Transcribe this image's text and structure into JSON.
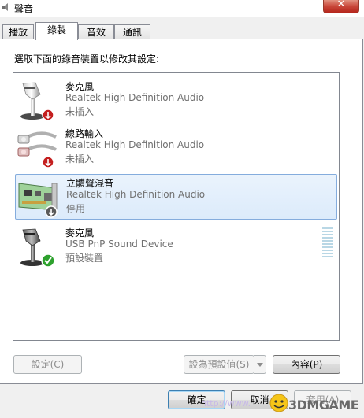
{
  "window": {
    "title": "聲音",
    "close_glyph": "✕"
  },
  "tabs": [
    {
      "label": "播放",
      "active": false
    },
    {
      "label": "錄製",
      "active": true
    },
    {
      "label": "音效",
      "active": false
    },
    {
      "label": "通訊",
      "active": false
    }
  ],
  "instruction": "選取下面的錄音裝置以修改其設定:",
  "devices": [
    {
      "name": "麥克風",
      "description": "Realtek High Definition Audio",
      "status": "未插入",
      "icon": "microphone-icon",
      "badge": "unplugged-badge-icon",
      "selected": false
    },
    {
      "name": "線路輸入",
      "description": "Realtek High Definition Audio",
      "status": "未插入",
      "icon": "line-in-cable-icon",
      "badge": "unplugged-badge-icon",
      "selected": false
    },
    {
      "name": "立體聲混音",
      "description": "Realtek High Definition Audio",
      "status": "停用",
      "icon": "sound-card-icon",
      "badge": "disabled-badge-icon",
      "selected": true
    },
    {
      "name": "麥克風",
      "description": "USB PnP Sound Device",
      "status": "預設裝置",
      "icon": "microphone-icon",
      "badge": "default-check-badge-icon",
      "selected": false,
      "level": 0
    }
  ],
  "buttons": {
    "configure": "設定(C)",
    "set_default": "設為預設值(S)",
    "properties": "內容(P)",
    "ok": "確定",
    "cancel": "取消",
    "apply": "套用(A)"
  },
  "overlay": {
    "url_fragment": "http://www.",
    "brand": "3DMGAME"
  },
  "colors": {
    "selection_border": "#84acdd",
    "close_button": "#c9483a",
    "check_green": "#2ea12e",
    "unplugged_red": "#c41f1f"
  }
}
